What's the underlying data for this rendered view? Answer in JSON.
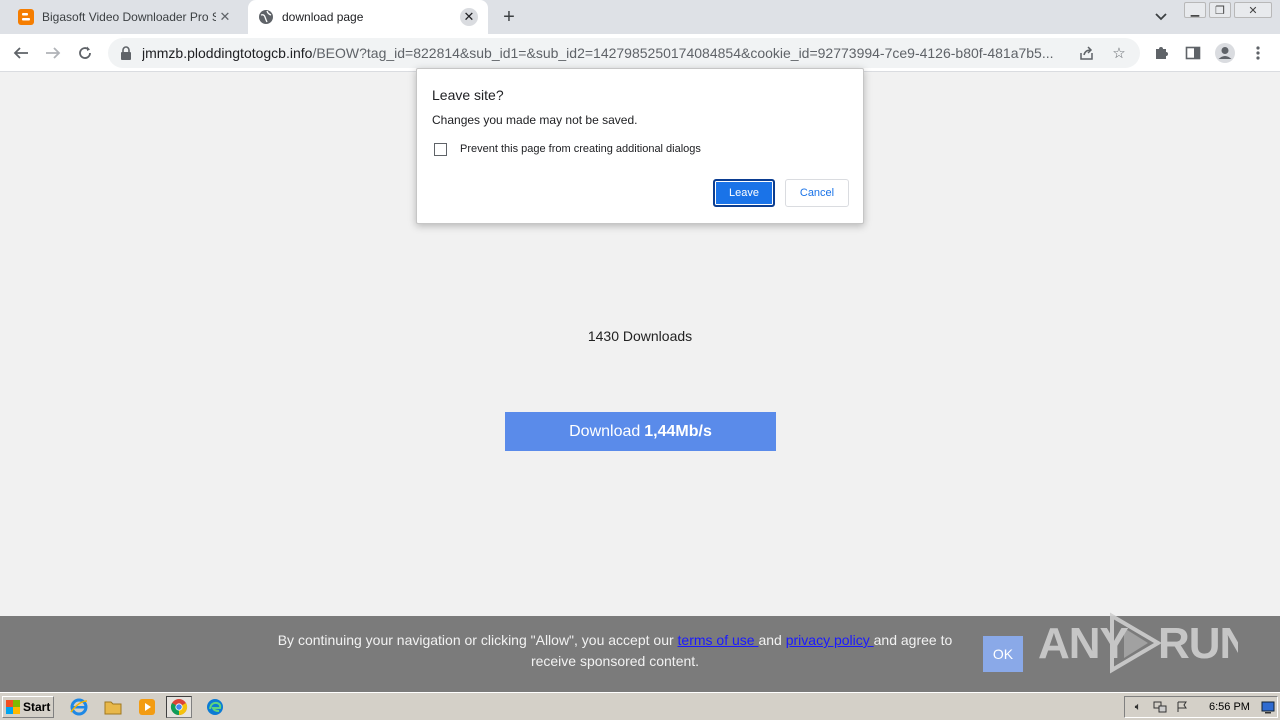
{
  "browser": {
    "tabs": [
      {
        "title": "Bigasoft Video Downloader Pro Serial",
        "icon": "blogger-icon",
        "active": false
      },
      {
        "title": "download page",
        "icon": "globe-icon",
        "active": true
      }
    ],
    "url_host": "jmmzb.ploddingtotogcb.info",
    "url_path": "/BEOW?tag_id=822814&sub_id1=&sub_id2=1427985250174084854&cookie_id=92773994-7ce9-4126-b80f-481a7b5..."
  },
  "dialog": {
    "title": "Leave site?",
    "message": "Changes you made may not be saved.",
    "checkbox_label": "Prevent this page from creating additional dialogs",
    "leave_label": "Leave",
    "cancel_label": "Cancel"
  },
  "page": {
    "downloads_count": "1430 Downloads",
    "download_label": "Download",
    "download_speed": "1,44Mb/s"
  },
  "banner": {
    "text_before": "By continuing your navigation or clicking \"Allow\", you accept our ",
    "terms_link": "terms of use ",
    "text_middle": "and ",
    "privacy_link": "privacy policy ",
    "text_after": "and agree to receive sponsored content.",
    "ok_label": "OK"
  },
  "watermark": {
    "text": "ANY RUN"
  },
  "taskbar": {
    "start_label": "Start",
    "clock": "6:56 PM"
  },
  "colors": {
    "download_button": "#5a8bea",
    "dialog_primary": "#1a73e8",
    "banner_bg": "#7b7b7b"
  }
}
